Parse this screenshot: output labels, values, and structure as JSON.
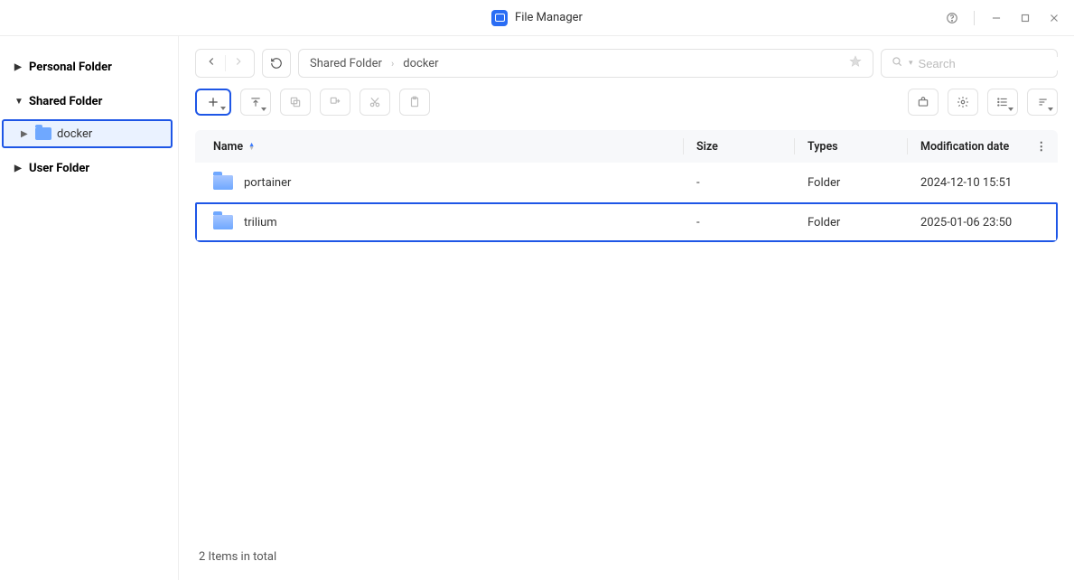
{
  "app": {
    "title": "File Manager"
  },
  "sidebar": {
    "items": [
      {
        "label": "Personal Folder",
        "expanded": false
      },
      {
        "label": "Shared Folder",
        "expanded": true,
        "children": [
          {
            "label": "docker",
            "selected": true
          }
        ]
      },
      {
        "label": "User Folder",
        "expanded": false
      }
    ]
  },
  "breadcrumb": [
    "Shared Folder",
    "docker"
  ],
  "search": {
    "placeholder": "Search"
  },
  "columns": {
    "name": "Name",
    "size": "Size",
    "types": "Types",
    "modified": "Modification date"
  },
  "rows": [
    {
      "name": "portainer",
      "size": "-",
      "types": "Folder",
      "modified": "2024-12-10 15:51",
      "highlighted": false
    },
    {
      "name": "trilium",
      "size": "-",
      "types": "Folder",
      "modified": "2025-01-06 23:50",
      "highlighted": true
    }
  ],
  "status": "2 Items in total"
}
